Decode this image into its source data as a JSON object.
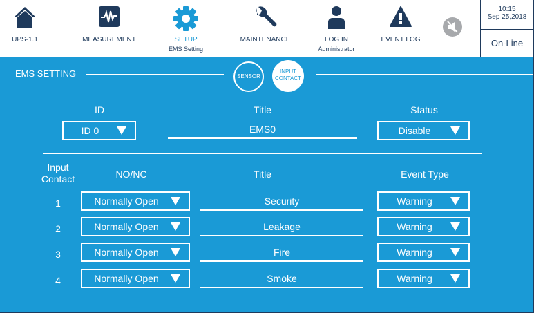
{
  "nav": [
    {
      "label": "UPS-1.1",
      "icon": "home-icon"
    },
    {
      "label": "MEASUREMENT",
      "icon": "waveform-icon"
    },
    {
      "label": "SETUP",
      "sub": "EMS Setting",
      "icon": "gear-icon"
    },
    {
      "label": "MAINTENANCE",
      "icon": "wrench-icon"
    },
    {
      "label": "LOG IN",
      "sub": "Administrator",
      "icon": "user-icon"
    },
    {
      "label": "EVENT LOG",
      "icon": "warning-icon"
    }
  ],
  "clock": {
    "time": "10:15",
    "date": "Sep 25,2018"
  },
  "status": "On-Line",
  "panel": {
    "section_title": "EMS SETTING",
    "tab_sensor": "SENSOR",
    "tab_input": "INPUT CONTACT",
    "id_label": "ID",
    "title_label": "Title",
    "status_label": "Status",
    "id_value": "ID 0",
    "title_value": "EMS0",
    "status_value": "Disable",
    "col_input_contact": "Input Contact",
    "col_nonc": "NO/NC",
    "col_title": "Title",
    "col_event_type": "Event Type",
    "rows": [
      {
        "num": "1",
        "nonc": "Normally Open",
        "title": "Security",
        "event": "Warning"
      },
      {
        "num": "2",
        "nonc": "Normally Open",
        "title": "Leakage",
        "event": "Warning"
      },
      {
        "num": "3",
        "nonc": "Normally Open",
        "title": "Fire",
        "event": "Warning"
      },
      {
        "num": "4",
        "nonc": "Normally Open",
        "title": "Smoke",
        "event": "Warning"
      }
    ]
  },
  "colors": {
    "accent": "#1a9ad6",
    "dark": "#1f3a5c",
    "muted": "#a7a9ac"
  }
}
